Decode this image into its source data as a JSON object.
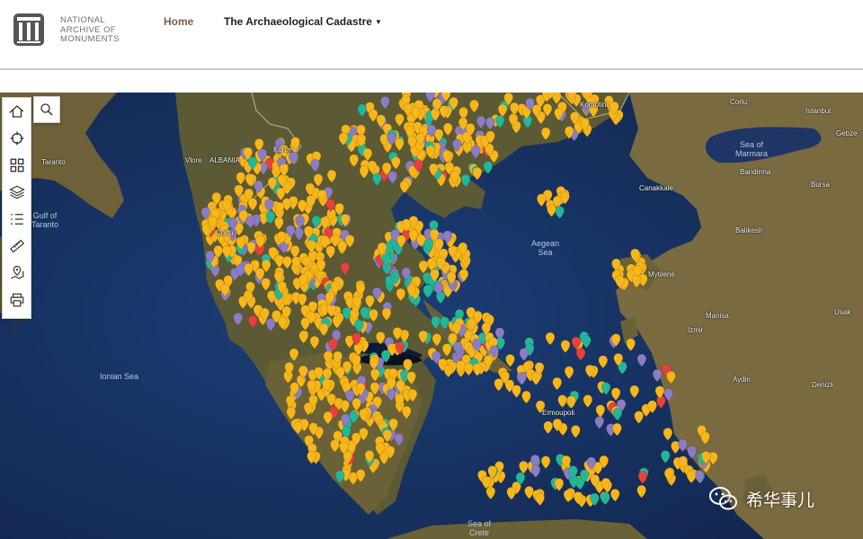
{
  "header": {
    "logo": {
      "line1": "NATIONAL",
      "line2": "ARCHIVE OF",
      "line3": "MONUMENTS"
    },
    "nav": {
      "home": "Home",
      "cadastre": "The Archaeological Cadastre"
    }
  },
  "toolbar": {
    "tools": [
      "home-icon",
      "locate-icon",
      "grid-icon",
      "layers-icon",
      "legend-icon",
      "measure-icon",
      "map-marker-icon",
      "print-icon",
      "refresh-icon"
    ],
    "search_icon": "search-icon"
  },
  "map": {
    "place_labels": {
      "istanbul": "Istanbul",
      "gebze": "Gebze",
      "corlu": "Corlu",
      "bandirma": "Bandirma",
      "bursa": "Bursa",
      "canakkale": "Canakkale",
      "balikesir": "Balikesir",
      "mytilene": "Mytilene",
      "manisa": "Manisa",
      "usak": "Usak",
      "izmir": "Izmir",
      "aydin": "Aydin",
      "denizli": "Denizli",
      "taranto": "Taranto",
      "vlore": "Vlore",
      "albania": "ALBANIA",
      "korce": "Korce",
      "corfu": "Corfu",
      "komotini": "Komotini",
      "ermoupoli": "Ermoupoli"
    },
    "sea_labels": {
      "marmara": "Sea of\nMarmara",
      "aegean": "Aegean\nSea",
      "ionian": "Ionian Sea",
      "taranto_gulf": "Gulf of\nTaranto",
      "crete": "Sea of\nCrete"
    },
    "marker_colors": {
      "yellow": "#f7b61a",
      "purple": "#8c7cc4",
      "teal": "#22b79a",
      "red": "#e8413c"
    }
  },
  "watermark": {
    "text": "希华事儿"
  }
}
